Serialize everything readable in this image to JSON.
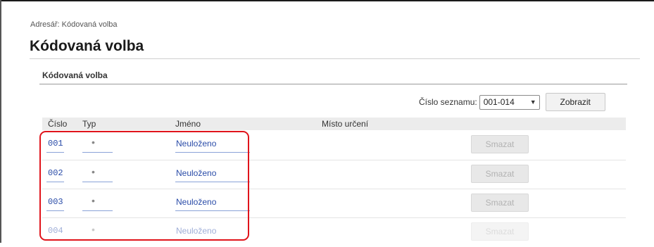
{
  "breadcrumb": "Adresář: Kódovaná volba",
  "page_title": "Kódovaná volba",
  "section_title": "Kódovaná volba",
  "toolbar": {
    "list_label": "Číslo seznamu:",
    "list_selected": "001-014",
    "show_label": "Zobrazit"
  },
  "table": {
    "headers": {
      "number": "Číslo",
      "type": "Typ",
      "name": "Jméno",
      "destination": "Místo určení"
    },
    "rows": [
      {
        "number": "001",
        "type": "•",
        "name": "Neuloženo",
        "destination": "",
        "delete_label": "Smazat"
      },
      {
        "number": "002",
        "type": "•",
        "name": "Neuloženo",
        "destination": "",
        "delete_label": "Smazat"
      },
      {
        "number": "003",
        "type": "•",
        "name": "Neuloženo",
        "destination": "",
        "delete_label": "Smazat"
      },
      {
        "number": "004",
        "type": "•",
        "name": "Neuloženo",
        "destination": "",
        "delete_label": "Smazat"
      }
    ]
  },
  "colors": {
    "link": "#2a4ca8",
    "highlight": "#e0141b",
    "header_bg": "#ececec",
    "disabled_text": "#b2b2b2"
  }
}
